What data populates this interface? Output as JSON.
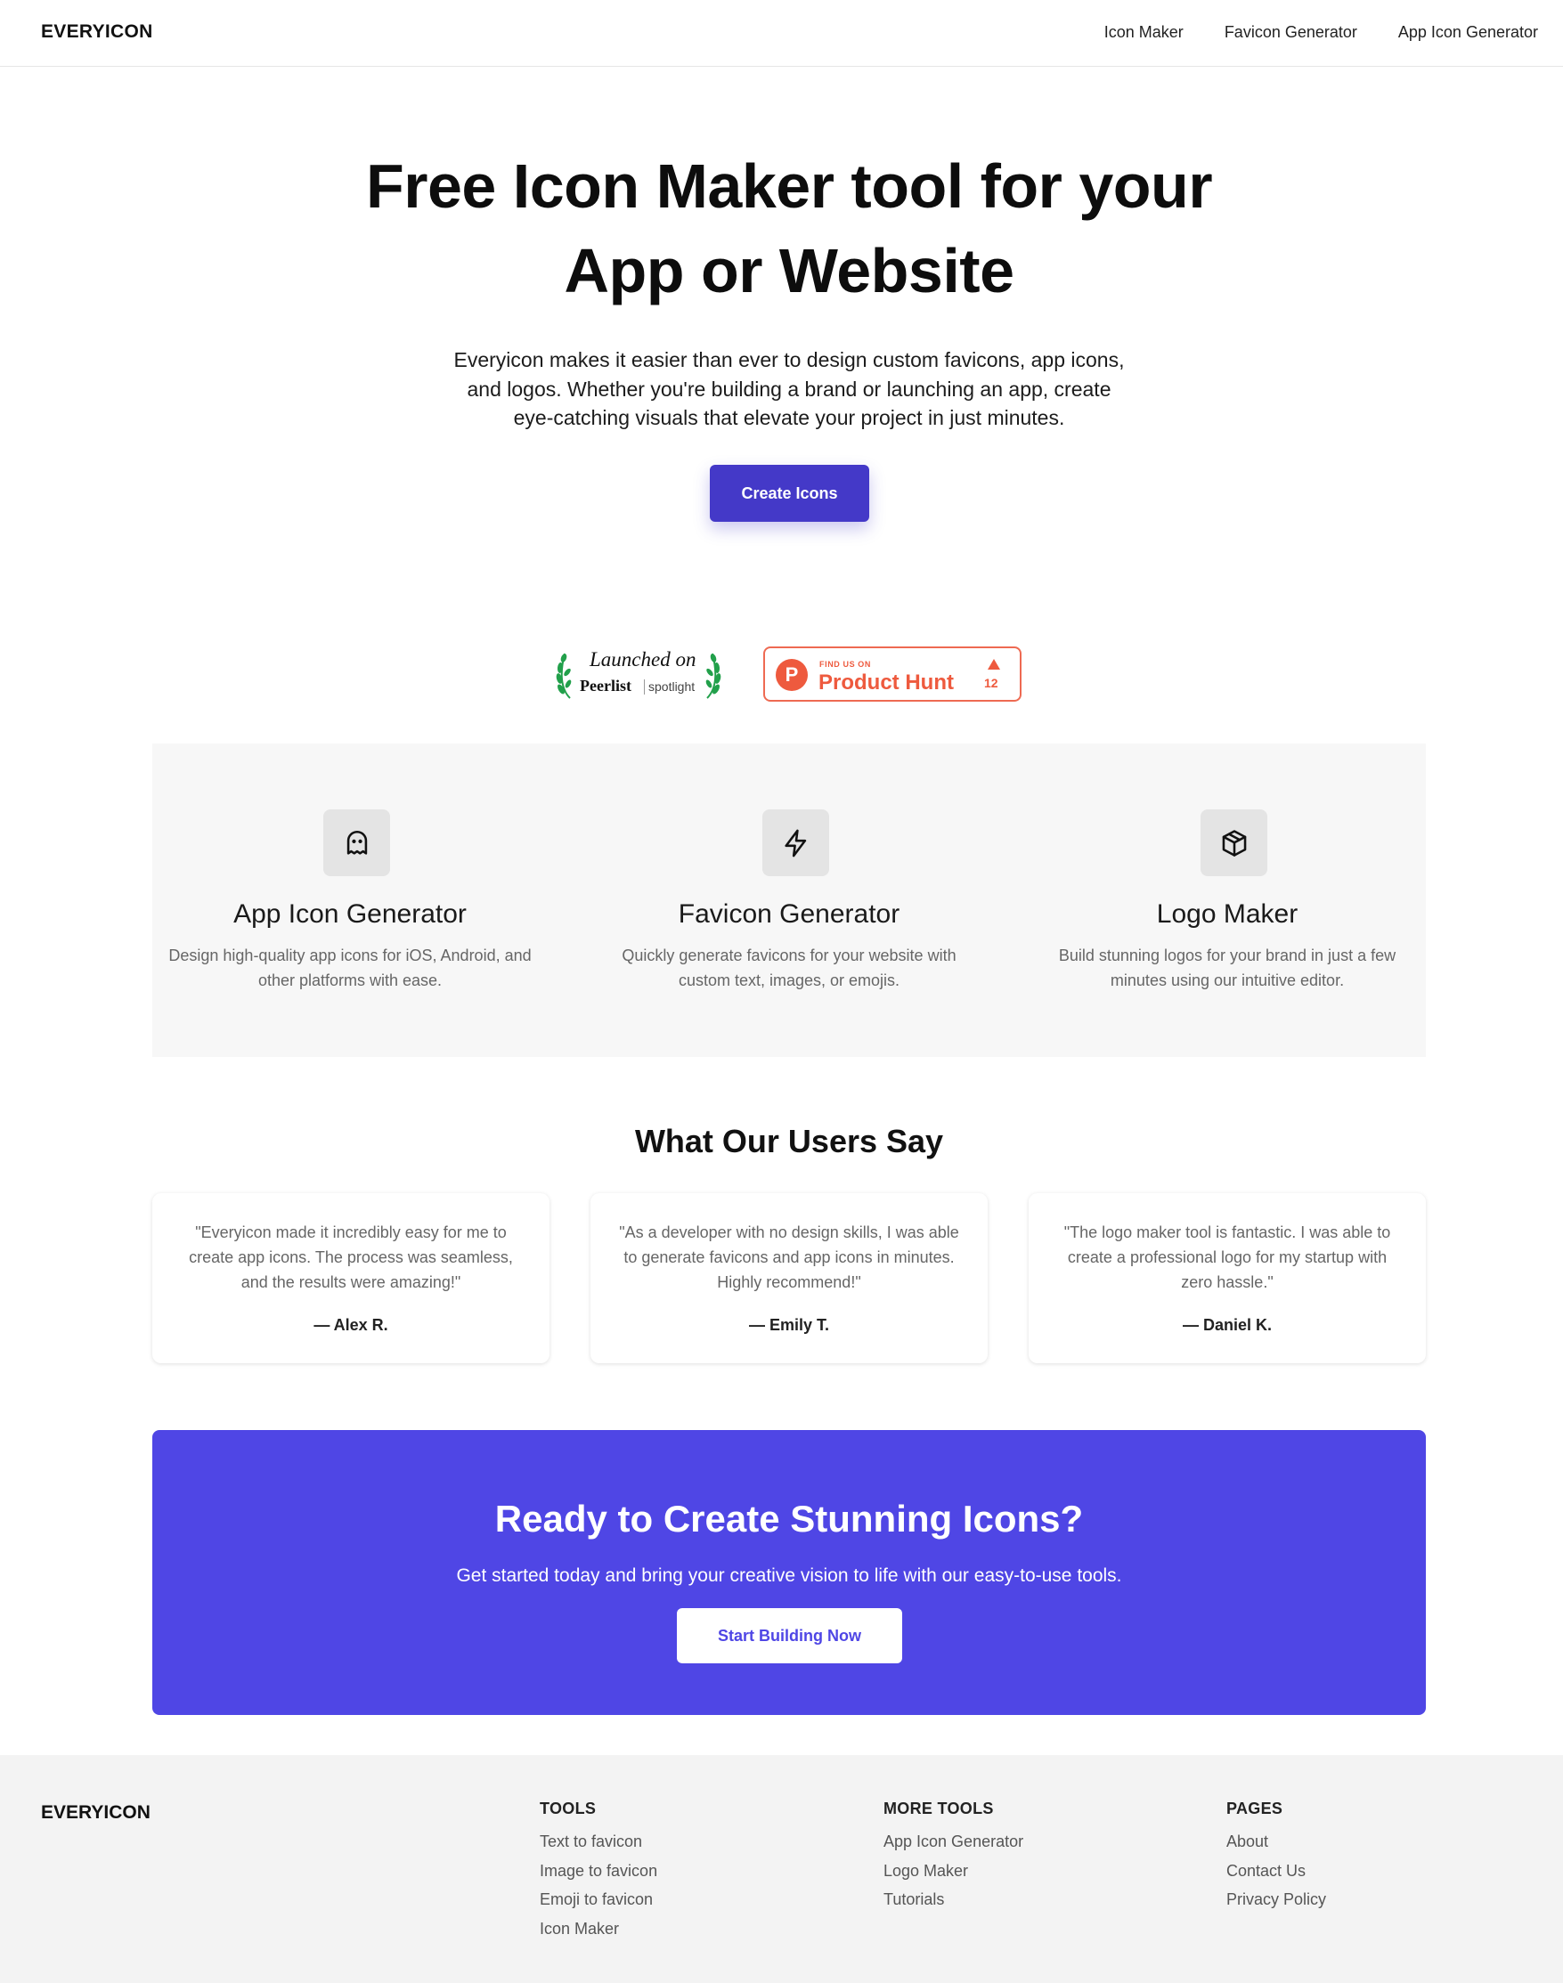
{
  "nav": {
    "brand": "EVERYICON",
    "links": [
      "Icon Maker",
      "Favicon Generator",
      "App Icon Generator"
    ]
  },
  "hero": {
    "title_line1": "Free Icon Maker tool for your",
    "title_line2": "App or Website",
    "subtitle": "Everyicon makes it easier than ever to design custom favicons, app icons, and logos. Whether you're building a brand or launching an app, create eye-catching visuals that elevate your project in just minutes.",
    "cta": "Create Icons"
  },
  "badges": {
    "peerlist": {
      "launched": "Launched on",
      "name": "Peerlist",
      "tag": "spotlight"
    },
    "producthunt": {
      "find": "FIND US ON",
      "name": "Product Hunt",
      "logo_letter": "P",
      "count": "12"
    }
  },
  "features": [
    {
      "icon": "ghost-icon",
      "title": "App Icon Generator",
      "description": "Design high-quality app icons for iOS, Android, and other platforms with ease."
    },
    {
      "icon": "lightning-icon",
      "title": "Favicon Generator",
      "description": "Quickly generate favicons for your website with custom text, images, or emojis."
    },
    {
      "icon": "box-icon",
      "title": "Logo Maker",
      "description": "Build stunning logos for your brand in just a few minutes using our intuitive editor."
    }
  ],
  "testimonials": {
    "title": "What Our Users Say",
    "items": [
      {
        "quote": "\"Everyicon made it incredibly easy for me to create app icons. The process was seamless, and the results were amazing!\"",
        "author": "— Alex R."
      },
      {
        "quote": "\"As a developer with no design skills, I was able to generate favicons and app icons in minutes. Highly recommend!\"",
        "author": "— Emily T."
      },
      {
        "quote": "\"The logo maker tool is fantastic. I was able to create a professional logo for my startup with zero hassle.\"",
        "author": "— Daniel K."
      }
    ]
  },
  "cta_band": {
    "title": "Ready to Create Stunning Icons?",
    "subtitle": "Get started today and bring your creative vision to life with our easy-to-use tools.",
    "button": "Start Building Now"
  },
  "footer": {
    "brand": "EVERYICON",
    "columns": [
      {
        "heading": "TOOLS",
        "links": [
          "Text to favicon",
          "Image to favicon",
          "Emoji to favicon",
          "Icon Maker"
        ]
      },
      {
        "heading": "MORE TOOLS",
        "links": [
          "App Icon Generator",
          "Logo Maker",
          "Tutorials"
        ]
      },
      {
        "heading": "PAGES",
        "links": [
          "About",
          "Contact Us",
          "Privacy Policy"
        ]
      }
    ]
  },
  "colors": {
    "primary": "#4439c8",
    "band": "#4f46e5",
    "producthunt": "#ee5a3e",
    "peerlist_green": "#22a04b",
    "feature_bg": "#f7f7f7",
    "footer_bg": "#f3f3f3"
  }
}
